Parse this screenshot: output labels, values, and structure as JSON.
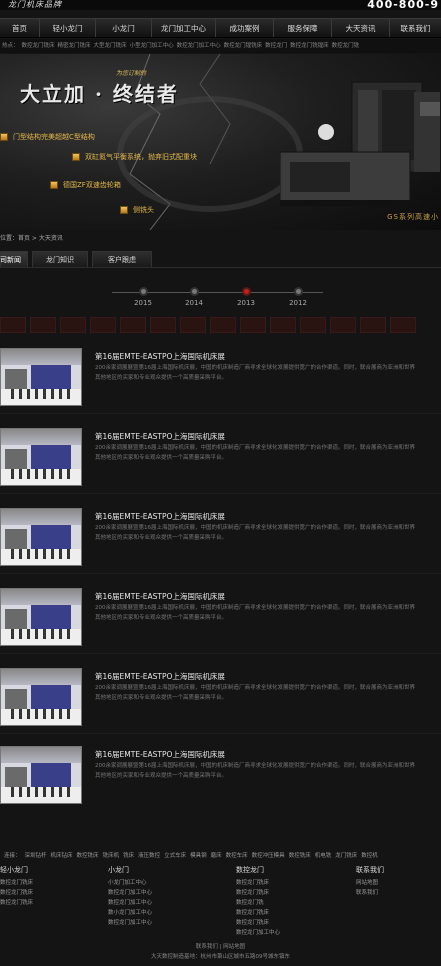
{
  "header": {
    "logo": "龙门机床品牌",
    "phone": "400-800-9"
  },
  "nav": [
    {
      "label": "首页",
      "active": true
    },
    {
      "label": "轻小龙门",
      "active": false
    },
    {
      "label": "小龙门",
      "active": false
    },
    {
      "label": "龙门加工中心",
      "active": false
    },
    {
      "label": "成功案例",
      "active": false
    },
    {
      "label": "服务保障",
      "active": false
    },
    {
      "label": "大天资讯",
      "active": false
    },
    {
      "label": "联系我们",
      "active": false
    }
  ],
  "keywords": [
    "热点：",
    "数控龙门铣床",
    "精密龙门铣床",
    "大型龙门铣床",
    "小型龙门加工中心",
    "数控龙门加工中心",
    "数控龙门镗铣床",
    "数控龙门",
    "数控龙门铣镗床",
    "数控龙门铣"
  ],
  "banner": {
    "tag": "为您订制的",
    "title": "大立加 · 终结者",
    "features": [
      "门型结构完美超越C型结构",
      "双缸氮气平衡系统，抛弃旧式配重块",
      "德国ZF双速齿轮箱",
      "侧铣头"
    ],
    "slogan": "GS系列高速小"
  },
  "breadcrumb": "位置：首页 > 大天资讯",
  "tabs": [
    {
      "label": "公司新闻",
      "active": true
    },
    {
      "label": "龙门知识",
      "active": false
    },
    {
      "label": "客户跟虑",
      "active": false
    }
  ],
  "timeline": [
    {
      "year": "2015",
      "active": false
    },
    {
      "year": "2014",
      "active": false
    },
    {
      "year": "2013",
      "active": true
    },
    {
      "year": "2012",
      "active": false
    }
  ],
  "news": [
    {
      "title": "第16届EMTE-EASTPO上海国际机床展",
      "desc": "200余家调展展暨第16届上海国际机床展，中国的机床制造厂商寻求全球化发展提供宽广的合作渠道。同时，联合展商为亚洲和世界其他地区的买家和专业观众提供一个高质量采购平台。"
    },
    {
      "title": "第16届EMTE-EASTPO上海国际机床展",
      "desc": "200余家调展展暨第16届上海国际机床展，中国的机床制造厂商寻求全球化发展提供宽广的合作渠道。同时，联合展商为亚洲和世界其他地区的买家和专业观众提供一个高质量采购平台。"
    },
    {
      "title": "第16届EMTE-EASTPO上海国际机床展",
      "desc": "200余家调展展暨第16届上海国际机床展，中国的机床制造厂商寻求全球化发展提供宽广的合作渠道。同时，联合展商为亚洲和世界其他地区的买家和专业观众提供一个高质量采购平台。"
    },
    {
      "title": "第16届EMTE-EASTPO上海国际机床展",
      "desc": "200余家调展展暨第16届上海国际机床展，中国的机床制造厂商寻求全球化发展提供宽广的合作渠道。同时，联合展商为亚洲和世界其他地区的买家和专业观众提供一个高质量采购平台。"
    },
    {
      "title": "第16届EMTE-EASTPO上海国际机床展",
      "desc": "200余家调展展暨第16届上海国际机床展，中国的机床制造厂商寻求全球化发展提供宽广的合作渠道。同时，联合展商为亚洲和世界其他地区的买家和专业观众提供一个高质量采购平台。"
    },
    {
      "title": "第16届EMTE-EASTPO上海国际机床展",
      "desc": "200余家调展展暨第16届上海国际机床展，中国的机床制造厂商寻求全球化发展提供宽广的合作渠道。同时，联合展商为亚洲和世界其他地区的买家和专业观众提供一个高质量采购平台。"
    }
  ],
  "footer": {
    "keywords": [
      "连接：",
      "深圳钻杆",
      "机床钻床",
      "数控铣床",
      "铣床机",
      "铣床",
      "液压数控",
      "立式车床",
      "模具钢",
      "磨床",
      "数控车床",
      "数控冲压模具",
      "数控铣床",
      "机电铣",
      "龙门铣床",
      "数控机"
    ],
    "cols": [
      {
        "heading": "轻小龙门",
        "links": [
          "数控龙门铣床",
          "数控龙门铣床",
          "数控龙门铣床"
        ]
      },
      {
        "heading": "小龙门",
        "links": [
          "小龙门加工中心",
          "数控龙门加工中心",
          "数控龙门加工中心",
          "数小龙门加工中心",
          "数控龙门加工中心"
        ]
      },
      {
        "heading": "数控龙门",
        "links": [
          "数控龙门铣床",
          "数控龙门铣床",
          "数控龙门铣",
          "数控龙门铣床",
          "数控龙门铣床",
          "数控龙门加工中心"
        ]
      },
      {
        "heading": "联系我们",
        "links": [
          "网站地图",
          "联系我们"
        ]
      }
    ],
    "bottom1": "联系我们 | 网站地图",
    "bottom2": "大天数控制造基地：杭州市萧山区城市五路09号城东镇东"
  }
}
